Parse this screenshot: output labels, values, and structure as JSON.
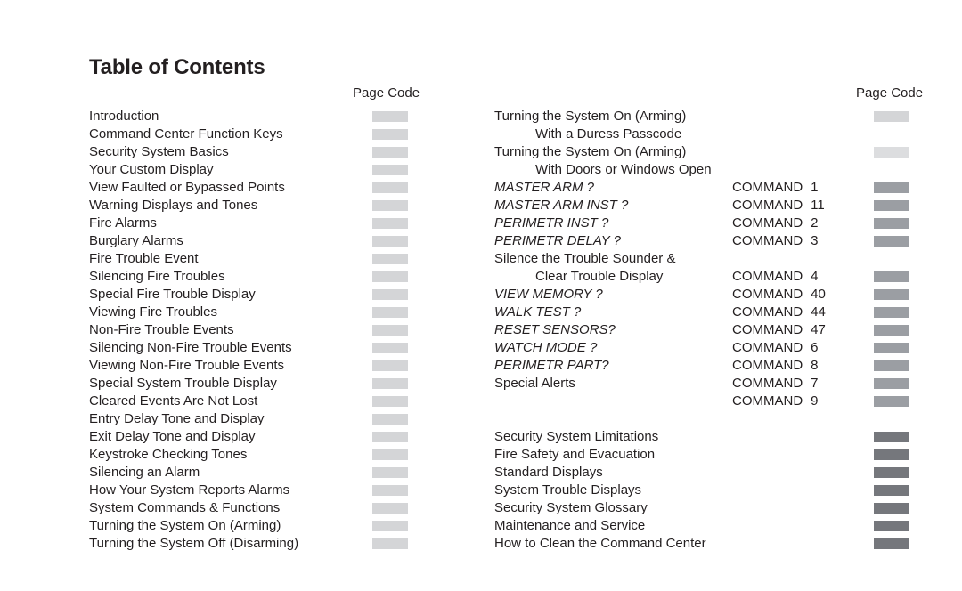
{
  "document": {
    "title": "Table of Contents"
  },
  "colors": {
    "text": "#231f20",
    "code_light": "#d4d5d7",
    "code_lighter": "#dcdddf",
    "code_medium": "#9b9ea3",
    "code_dark": "#75777c"
  },
  "left_column": {
    "page_code_header": "Page Code",
    "entries": [
      {
        "title": "Introduction",
        "code_shade": "code_light"
      },
      {
        "title": "Command Center Function Keys",
        "code_shade": "code_light"
      },
      {
        "title": "Security System Basics",
        "code_shade": "code_light"
      },
      {
        "title": "Your Custom Display",
        "code_shade": "code_light"
      },
      {
        "title": "View Faulted or Bypassed Points",
        "code_shade": "code_light"
      },
      {
        "title": "Warning Displays and Tones",
        "code_shade": "code_light"
      },
      {
        "title": "Fire Alarms",
        "code_shade": "code_light"
      },
      {
        "title": "Burglary Alarms",
        "code_shade": "code_light"
      },
      {
        "title": "Fire Trouble Event",
        "code_shade": "code_light"
      },
      {
        "title": "Silencing Fire Troubles",
        "code_shade": "code_light"
      },
      {
        "title": "Special Fire Trouble Display",
        "code_shade": "code_light"
      },
      {
        "title": "Viewing Fire Troubles",
        "code_shade": "code_light"
      },
      {
        "title": "Non-Fire Trouble Events",
        "code_shade": "code_light"
      },
      {
        "title": "Silencing Non-Fire Trouble Events",
        "code_shade": "code_light"
      },
      {
        "title": "Viewing Non-Fire Trouble Events",
        "code_shade": "code_light"
      },
      {
        "title": "Special System Trouble Display",
        "code_shade": "code_light"
      },
      {
        "title": "Cleared Events Are Not Lost",
        "code_shade": "code_light"
      },
      {
        "title": "Entry Delay Tone and Display",
        "code_shade": "code_light"
      },
      {
        "title": "Exit Delay Tone and Display",
        "code_shade": "code_light"
      },
      {
        "title": "Keystroke Checking Tones",
        "code_shade": "code_light"
      },
      {
        "title": "Silencing an Alarm",
        "code_shade": "code_light"
      },
      {
        "title": "How Your System Reports Alarms",
        "code_shade": "code_light"
      },
      {
        "title": "System Commands & Functions",
        "code_shade": "code_light"
      },
      {
        "title": "Turning the System On (Arming)",
        "code_shade": "code_light"
      },
      {
        "title": "Turning the System Off (Disarming)",
        "code_shade": "code_light"
      }
    ]
  },
  "right_column": {
    "page_code_header": "Page Code",
    "entries": [
      {
        "title": "Turning the System On (Arming)",
        "indent": false,
        "italic": false,
        "command": "",
        "code_shade": "code_light"
      },
      {
        "title": "With a Duress Passcode",
        "indent": true,
        "italic": false,
        "command": "",
        "code_shade": ""
      },
      {
        "title": "Turning the System On (Arming)",
        "indent": false,
        "italic": false,
        "command": "",
        "code_shade": "code_lighter"
      },
      {
        "title": "With Doors or Windows Open",
        "indent": true,
        "italic": false,
        "command": "",
        "code_shade": ""
      },
      {
        "title": "MASTER ARM ?",
        "indent": false,
        "italic": true,
        "command": "COMMAND",
        "command_number": "1",
        "code_shade": "code_medium"
      },
      {
        "title": "MASTER ARM INST ?",
        "indent": false,
        "italic": true,
        "command": "COMMAND",
        "command_number": "11",
        "code_shade": "code_medium"
      },
      {
        "title": "PERIMETR INST ?",
        "indent": false,
        "italic": true,
        "command": "COMMAND",
        "command_number": "2",
        "code_shade": "code_medium"
      },
      {
        "title": "PERIMETR DELAY ?",
        "indent": false,
        "italic": true,
        "command": "COMMAND",
        "command_number": "3",
        "code_shade": "code_medium"
      },
      {
        "title": "Silence the Trouble Sounder &",
        "indent": false,
        "italic": false,
        "command": "",
        "code_shade": ""
      },
      {
        "title": "Clear Trouble Display",
        "indent": true,
        "italic": false,
        "command": "COMMAND",
        "command_number": "4",
        "code_shade": "code_medium"
      },
      {
        "title": "VIEW MEMORY ?",
        "indent": false,
        "italic": true,
        "command": "COMMAND",
        "command_number": "40",
        "code_shade": "code_medium"
      },
      {
        "title": "WALK TEST ?",
        "indent": false,
        "italic": true,
        "command": "COMMAND",
        "command_number": "44",
        "code_shade": "code_medium"
      },
      {
        "title": "RESET SENSORS?",
        "indent": false,
        "italic": true,
        "command": "COMMAND",
        "command_number": "47",
        "code_shade": "code_medium"
      },
      {
        "title": "WATCH MODE ?",
        "indent": false,
        "italic": true,
        "command": "COMMAND",
        "command_number": "6",
        "code_shade": "code_medium"
      },
      {
        "title": "PERIMETR PART?",
        "indent": false,
        "italic": true,
        "command": "COMMAND",
        "command_number": "8",
        "code_shade": "code_medium"
      },
      {
        "title": "Special Alerts",
        "indent": false,
        "italic": false,
        "command": "COMMAND",
        "command_number": "7",
        "code_shade": "code_medium"
      },
      {
        "title": "",
        "indent": false,
        "italic": false,
        "command": "COMMAND",
        "command_number": "9",
        "code_shade": "code_medium"
      },
      {
        "spacer": true
      },
      {
        "title": "Security System Limitations",
        "indent": false,
        "italic": false,
        "command": "",
        "code_shade": "code_dark"
      },
      {
        "title": "Fire Safety and Evacuation",
        "indent": false,
        "italic": false,
        "command": "",
        "code_shade": "code_dark"
      },
      {
        "title": "Standard Displays",
        "indent": false,
        "italic": false,
        "command": "",
        "code_shade": "code_dark"
      },
      {
        "title": "System Trouble Displays",
        "indent": false,
        "italic": false,
        "command": "",
        "code_shade": "code_dark"
      },
      {
        "title": "Security System Glossary",
        "indent": false,
        "italic": false,
        "command": "",
        "code_shade": "code_dark"
      },
      {
        "title": "Maintenance and Service",
        "indent": false,
        "italic": false,
        "command": "",
        "code_shade": "code_dark"
      },
      {
        "title": "How to Clean the Command Center",
        "indent": false,
        "italic": false,
        "command": "",
        "code_shade": "code_dark"
      }
    ]
  }
}
